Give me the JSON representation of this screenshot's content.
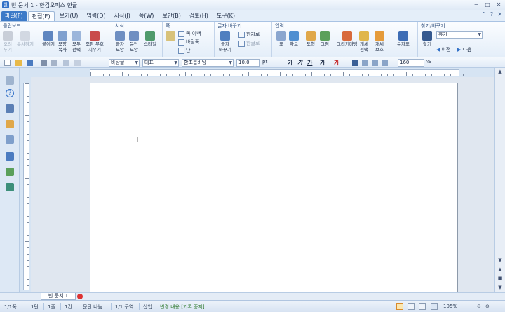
{
  "window": {
    "title": "빈 문서 1 - 한컴오피스 한글",
    "app_icon": "hwp-app-icon"
  },
  "menubar": {
    "items": [
      {
        "label": "파일(F)",
        "style": "file"
      },
      {
        "label": "편집(E)",
        "style": "active"
      },
      {
        "label": "보기(U)",
        "style": ""
      },
      {
        "label": "입력(D)",
        "style": ""
      },
      {
        "label": "서식(J)",
        "style": ""
      },
      {
        "label": "쪽(W)",
        "style": ""
      },
      {
        "label": "보안(B)",
        "style": ""
      },
      {
        "label": "검토(H)",
        "style": ""
      },
      {
        "label": "도구(K)",
        "style": ""
      }
    ]
  },
  "ribbon": {
    "clipboard": {
      "title": "클립보드",
      "cut": "오려\n두기",
      "copy": "복사하기",
      "paste": "붙이기",
      "format_copy": "모양\n복사",
      "select_all": "모두\n선택",
      "clear_format": "조판 부호\n지우기"
    },
    "format": {
      "title": "서식",
      "char_shape": "글자\n모양",
      "para_shape": "문단\n모양",
      "style": "스타일"
    },
    "page": {
      "title": "쪽",
      "page_margin": "쪽 여백",
      "page_bg": "바탕쪽",
      "column": "단"
    },
    "char_change": {
      "title": "글자 바꾸기",
      "char_change": "글자\n바꾸기",
      "hanja": "한자로",
      "hangul": "한글로"
    },
    "insert": {
      "title": "입력",
      "table": "표",
      "chart": "차트",
      "shape": "도형",
      "picture": "그림",
      "drawing": "그리기마당",
      "obj_select": "개체\n선택",
      "obj_protect": "개체\n보호",
      "char_table": "문자표"
    },
    "find": {
      "title": "찾기/바꾸기",
      "find": "찾기",
      "find_value": "휴가",
      "prev": "이전",
      "next": "다음"
    }
  },
  "toolbar": {
    "style_select": "바탕글",
    "lang_select": "대표",
    "font_select": "함초롬바탕",
    "font_size": "10.0",
    "unit": "pt",
    "bold": "가",
    "italic": "가",
    "underline": "가",
    "strike": "가",
    "color": "가",
    "zoom": "160",
    "zoom_unit": "%"
  },
  "document": {
    "tab_label": "빈 문서 1"
  },
  "statusbar": {
    "page": "1/1쪽",
    "column": "1단",
    "line": "1줄",
    "col": "1칸",
    "para_break": "문단 나눔",
    "section": "1/1 구역",
    "insert_mode": "삽입",
    "track_changes": "변경 내용 [기록 중지]",
    "zoom": "105%"
  }
}
